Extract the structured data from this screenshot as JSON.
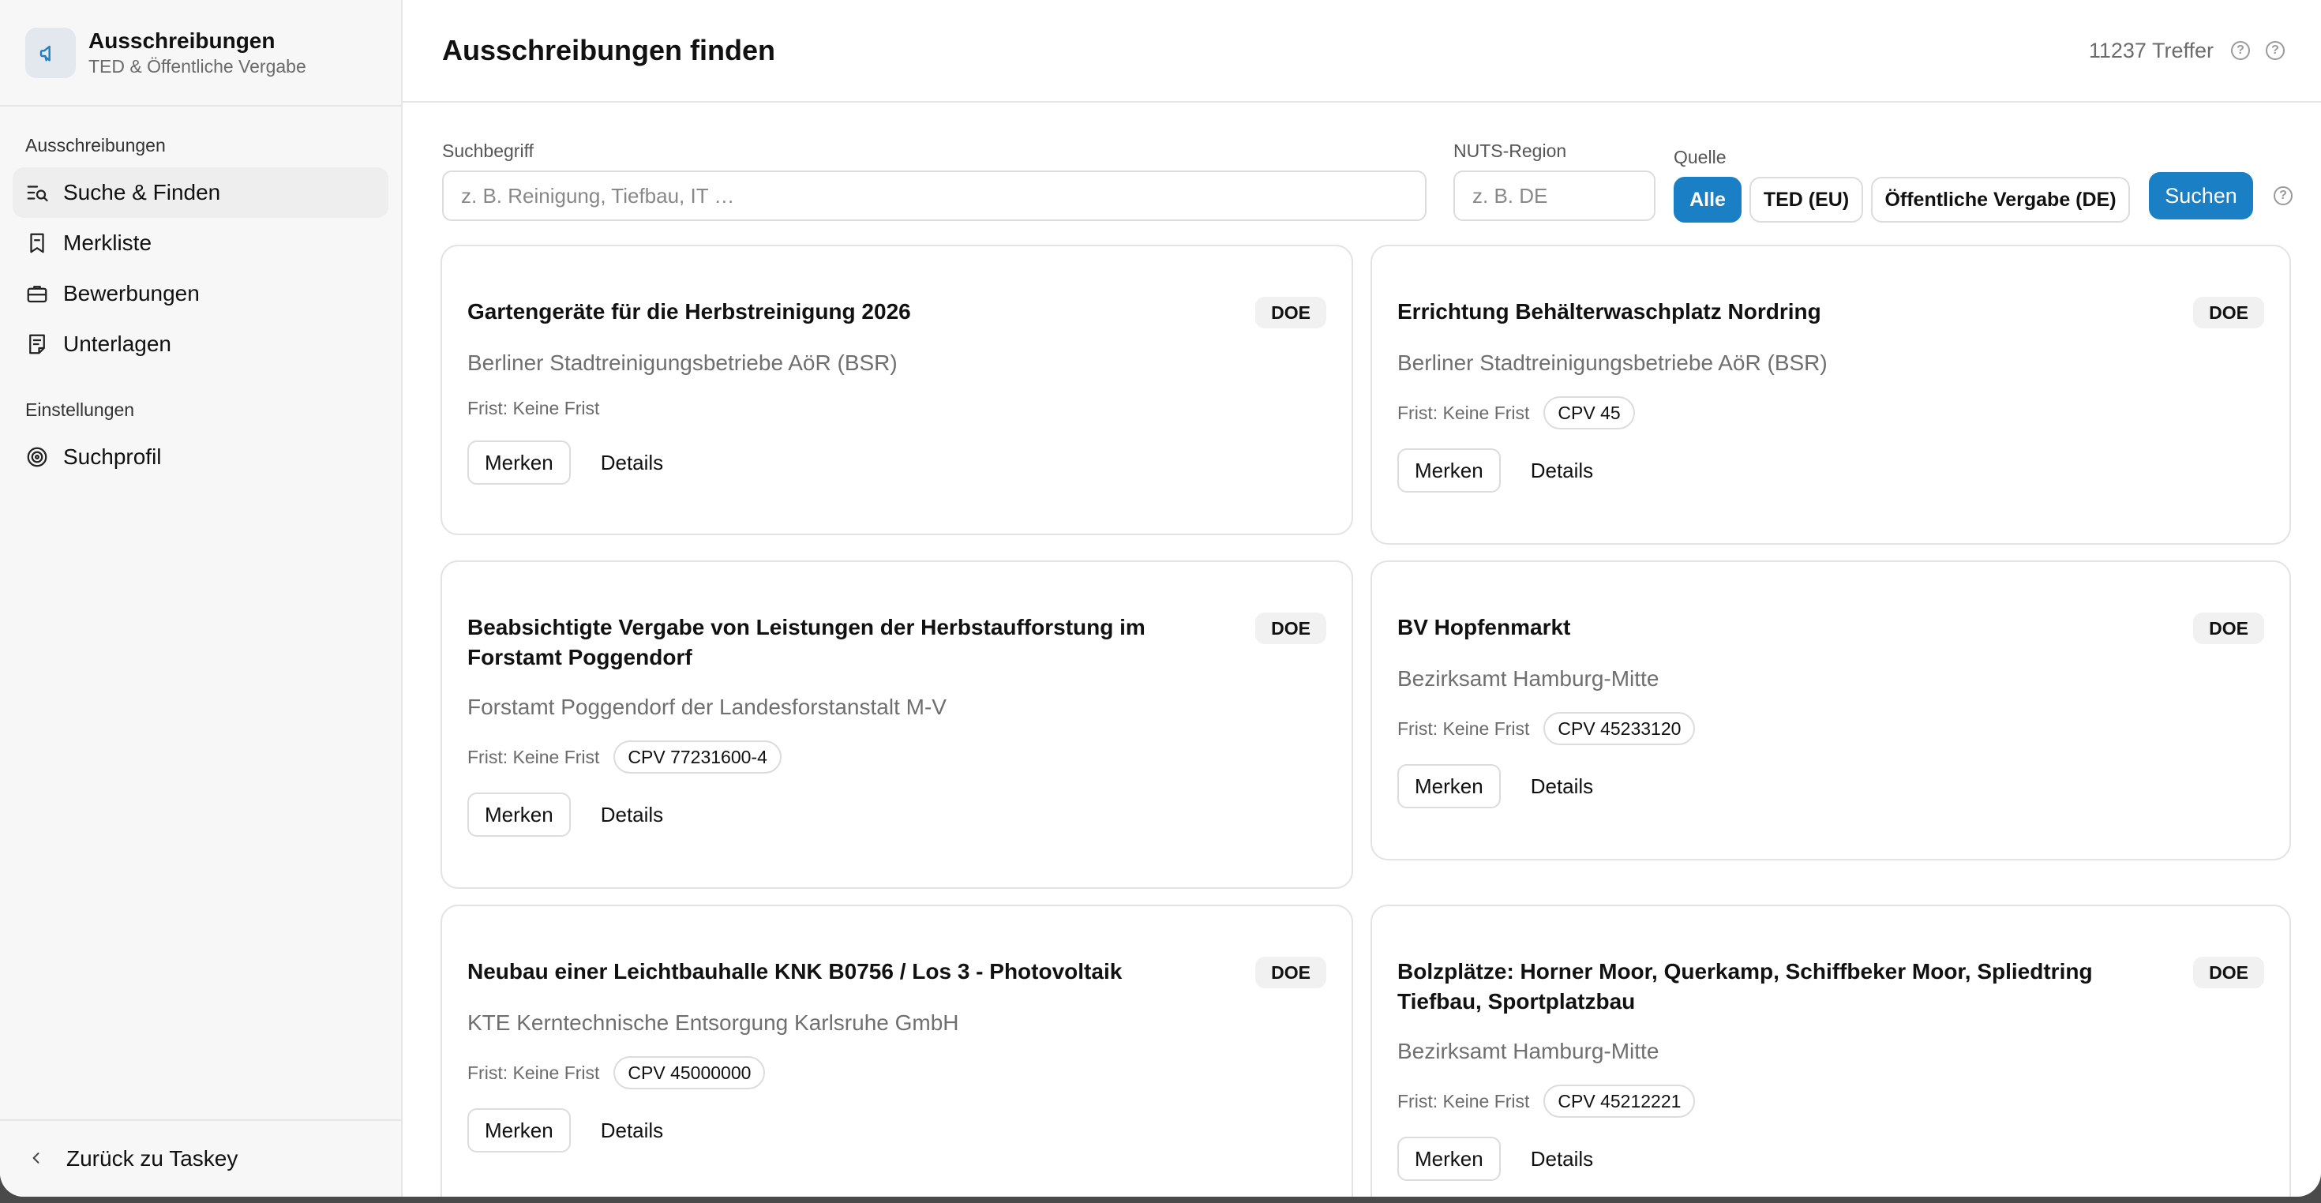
{
  "sidebar": {
    "brand_title": "Ausschreibungen",
    "brand_subtitle": "TED & Öffentliche Vergabe",
    "section1": "Ausschreibungen",
    "items": [
      {
        "label": "Suche & Finden",
        "icon": "search-list-icon"
      },
      {
        "label": "Merkliste",
        "icon": "bookmark-icon"
      },
      {
        "label": "Bewerbungen",
        "icon": "briefcase-icon"
      },
      {
        "label": "Unterlagen",
        "icon": "document-icon"
      }
    ],
    "section2": "Einstellungen",
    "settings_items": [
      {
        "label": "Suchprofil",
        "icon": "target-icon"
      }
    ],
    "footer": "Zurück zu Taskey"
  },
  "header": {
    "title": "Ausschreibungen finden",
    "hits": "11237 Treffer"
  },
  "filters": {
    "search_label": "Suchbegriff",
    "search_placeholder": "z. B. Reinigung, Tiefbau, IT …",
    "nuts_label": "NUTS-Region",
    "nuts_placeholder": "z. B. DE",
    "source_label": "Quelle",
    "sources": [
      "Alle",
      "TED (EU)",
      "Öffentliche Vergabe (DE)"
    ],
    "selected_source": "Alle",
    "search_button": "Suchen"
  },
  "cards": [
    {
      "title": "Gartengeräte für die Herbstreinigung 2026",
      "badge": "DOE",
      "org": "Berliner Stadtreinigungsbetriebe AöR (BSR)",
      "deadline": "Frist: Keine Frist",
      "cpv": "",
      "save": "Merken",
      "details": "Details"
    },
    {
      "title": "Errichtung Behälterwaschplatz Nordring",
      "badge": "DOE",
      "org": "Berliner Stadtreinigungsbetriebe AöR (BSR)",
      "deadline": "Frist: Keine Frist",
      "cpv": "CPV 45",
      "save": "Merken",
      "details": "Details"
    },
    {
      "title": "Beabsichtigte Vergabe von Leistungen der Herbstaufforstung im Forstamt Poggendorf",
      "badge": "DOE",
      "org": "Forstamt Poggendorf der Landesforstanstalt M-V",
      "deadline": "Frist: Keine Frist",
      "cpv": "CPV 77231600-4",
      "save": "Merken",
      "details": "Details"
    },
    {
      "title": "BV Hopfenmarkt",
      "badge": "DOE",
      "org": "Bezirksamt Hamburg-Mitte",
      "deadline": "Frist: Keine Frist",
      "cpv": "CPV 45233120",
      "save": "Merken",
      "details": "Details"
    },
    {
      "title": "Neubau einer Leichtbauhalle KNK B0756 / Los 3 - Photovoltaik",
      "badge": "DOE",
      "org": "KTE Kerntechnische Entsorgung Karlsruhe GmbH",
      "deadline": "Frist: Keine Frist",
      "cpv": "CPV 45000000",
      "save": "Merken",
      "details": "Details"
    },
    {
      "title": "Bolzplätze: Horner Moor, Querkamp, Schiffbeker Moor, Spliedtring Tiefbau, Sportplatzbau",
      "badge": "DOE",
      "org": "Bezirksamt Hamburg-Mitte",
      "deadline": "Frist: Keine Frist",
      "cpv": "CPV 45212221",
      "save": "Merken",
      "details": "Details"
    }
  ]
}
